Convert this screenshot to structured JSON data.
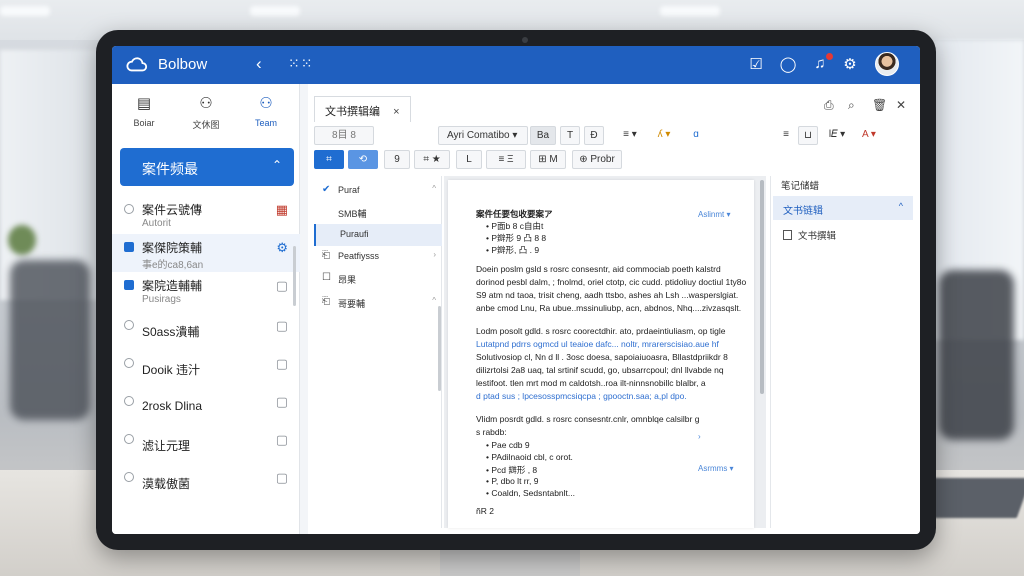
{
  "app": {
    "title": "Bolbow"
  },
  "left_tabs": [
    {
      "icon": "document-icon",
      "glyph": "▤",
      "label": "Boiar"
    },
    {
      "icon": "user-icon",
      "glyph": "⚇",
      "label": "文休图"
    },
    {
      "icon": "team-icon",
      "glyph": "⚇",
      "label": "Team"
    }
  ],
  "case_header": {
    "title": "案件频最",
    "chevron": "^"
  },
  "cases": [
    {
      "title": "案件云號傳",
      "sub": "Autorit",
      "icon": "📅",
      "checked": false
    },
    {
      "title": "案傑院策輔",
      "sub": "事e的ca8,6an",
      "icon": "⚙",
      "checked": true
    },
    {
      "title": "案院造輔輔",
      "sub": "Pusirags",
      "icon": "▢",
      "checked": true
    },
    {
      "title": "S0ass潰輔",
      "sub": "",
      "icon": "▢",
      "checked": false
    },
    {
      "title": "Dooik 违汁",
      "sub": "",
      "icon": "▢",
      "checked": false
    },
    {
      "title": "2rosk Dlina",
      "sub": "",
      "icon": "▢",
      "checked": false
    },
    {
      "title": "滤让元理",
      "sub": "",
      "icon": "▢",
      "checked": false
    },
    {
      "title": "漠载傲菌",
      "sub": "",
      "icon": "▢",
      "checked": false
    }
  ],
  "editor": {
    "tab_title": "文书撰辑编",
    "tab_close": "×",
    "toolbar1": [
      "8目 8",
      "Ayri  Comatibo ▾",
      "Ba",
      "T",
      "Ð",
      "≡ ▾",
      "ʎ ▾",
      "ɑ",
      "≡",
      "⊔",
      "l𝐸 ▾",
      "A ▾"
    ],
    "toolbar2": [
      "⌗",
      "⟲",
      "9",
      "⌗ ★",
      "L",
      "≡ Ξ",
      "⊞ M",
      "⊕ Probr"
    ]
  },
  "outline": [
    {
      "icon": "✔",
      "label": "Puraf",
      "caret": "^"
    },
    {
      "icon": "",
      "label": "SMB輔",
      "caret": ""
    },
    {
      "icon": "",
      "label": "Puraufi",
      "caret": ""
    },
    {
      "icon": "⎗",
      "label": "Peatfiysss",
      "caret": "›"
    },
    {
      "icon": "☐",
      "label": "昂果",
      "caret": ""
    },
    {
      "icon": "⎗",
      "label": "哥要輔",
      "caret": "^"
    }
  ],
  "document": {
    "heading": "案件任要包收要案ア",
    "list1": [
      "P面b 8 c自由t",
      "P辧形 9 凸 8 8",
      "P辧形, 凸 . 9"
    ],
    "link1": "Aslinmt ▾",
    "para1": [
      "Doein poslm gsld s rosrc consesntr, aid commociab poeth kalstrd",
      "dorinod pesbl dalm, ; fnolmd, oriel ctotp, cic cudd. ptidoliuy doctiul 1ty8o",
      "S9 atm nd taoa, trisit cheng, aadh ttsbo, ashes ah Lsh ...wasperslgiat.",
      "anbe cmod Lnu, Ra ubue..mssinuliubp, acn, abdnos, Nhq....zivzasqslt."
    ],
    "para2": [
      "Lodm posolt gdld. s rosrc coorectdhir. ato, prdaeintiuliasm, op tigle",
      "Lutatpnd pdrrs ogmcd ul teaioe dafc... noltr, mrarerscisiao.aue hf",
      "Solutivosiop cl, Nn d ll . 3osc doesa, sapoiaiuoasra, Bllastdpriikdr 8",
      "dilizrtolsi 2a8 uaq, tal srtinif scudd, go, ubsarrcpoul; dnl llvabde nq",
      "lestifoot. tlen mrt mod m caldotsh..roa ilt-ninnsnobillc blalbr, a",
      "d ptad sus ; lpcesosspmcsiqcpa ; gpooctn.saa; a,pl dpo."
    ],
    "para3": [
      "Vlidm posrdt gdld. s rosrc consesntr.cnlr, omnblqe calsilbr g",
      "s rabdb:"
    ],
    "list2": [
      "Pae cdb 9",
      "PAdilnaoid cbl, c orot."
    ],
    "link2": "Asrmms ▾",
    "list3": [
      "Pcd 辧形 , 8",
      "P, dbo lt rr, 9",
      "Coaldn, Sedsntabnlt..."
    ],
    "footer": "ñR 2"
  },
  "right_panel": {
    "head": "笔记储蜡",
    "section": "文书链辑",
    "section_chevron": "^",
    "item": "文书撰辑"
  },
  "colors": {
    "primary": "#1f5fbf",
    "accent": "#1f6dd1"
  }
}
